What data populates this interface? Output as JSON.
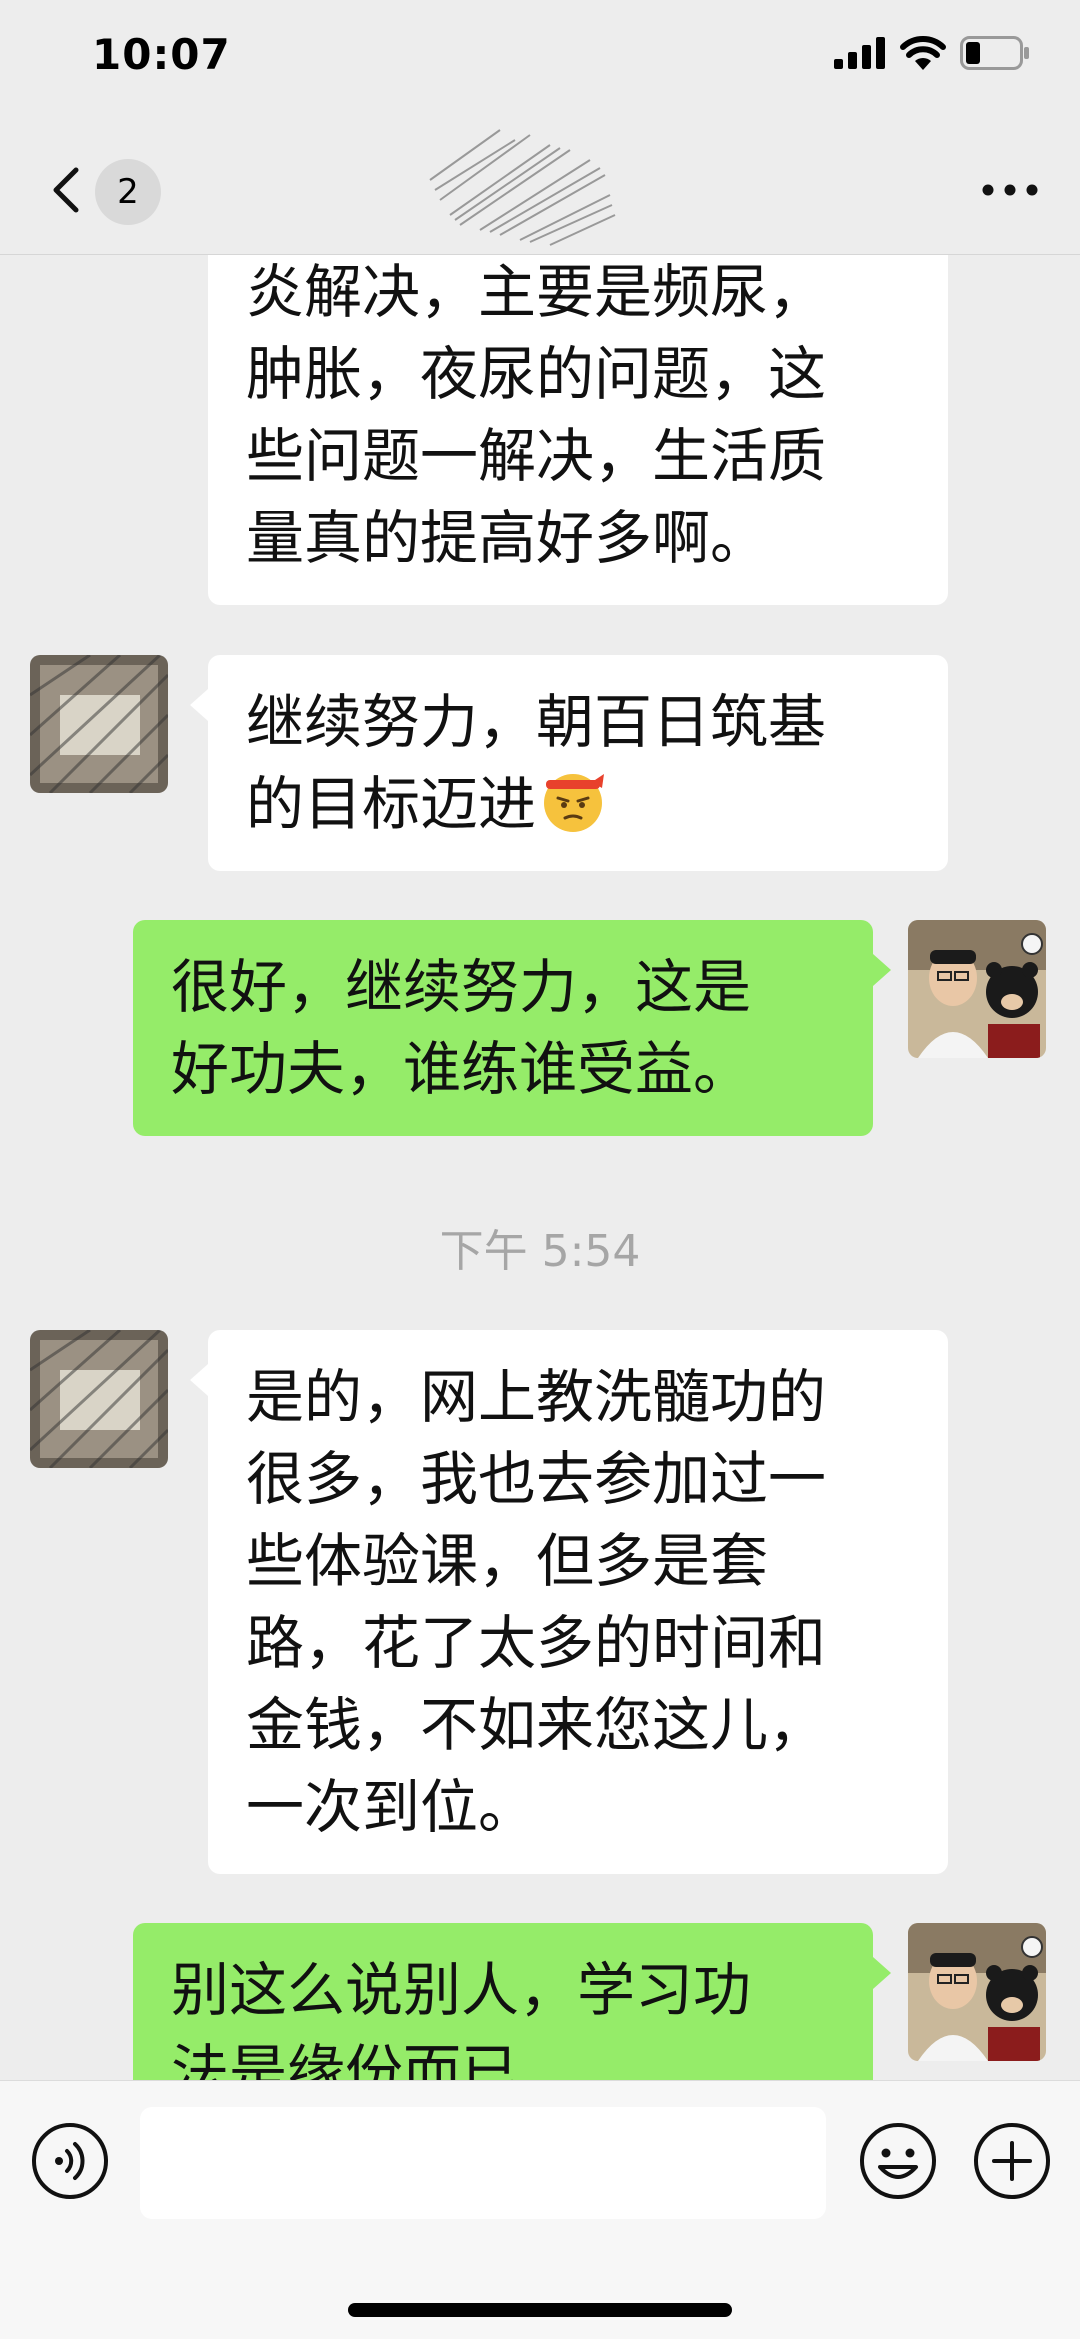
{
  "status_bar": {
    "time": "10:07"
  },
  "nav": {
    "unread_badge": "2",
    "title": ""
  },
  "messages": [
    {
      "side": "left",
      "text": "炎解决，主要是频尿，\n肿胀，夜尿的问题，这\n些问题一解决，生活质\n量真的提高好多啊。"
    },
    {
      "side": "left",
      "text": "继续努力，朝百日筑基\n的目标迈进"
    },
    {
      "side": "right",
      "text": "很好，继续努力，这是\n好功夫，谁练谁受益。"
    },
    {
      "side": "left",
      "text": "是的，网上教洗髓功的\n很多，我也去参加过一\n些体验课，但多是套\n路，花了太多的时间和\n金钱，不如来您这儿，\n一次到位。"
    },
    {
      "side": "right",
      "text": "别这么说别人，学习功\n法是缘份而已"
    }
  ],
  "timestamp": "下午 5:54",
  "input": {
    "value": "",
    "placeholder": ""
  },
  "colors": {
    "self_bubble": "#95ec69",
    "other_bubble": "#ffffff",
    "background": "#ededed"
  },
  "icons": [
    "back-icon",
    "more-icon",
    "voice-icon",
    "emoji-icon",
    "plus-icon",
    "signal-icon",
    "wifi-icon",
    "battery-icon"
  ]
}
